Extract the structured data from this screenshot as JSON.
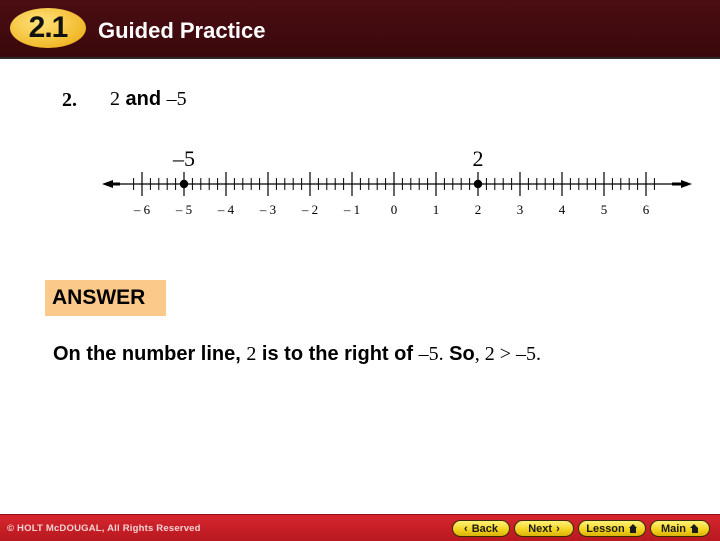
{
  "header": {
    "section_badge": "2.1",
    "title": "Guided Practice"
  },
  "problem": {
    "number": "2.",
    "expr_a": "2",
    "conj": " and ",
    "expr_b": "–5"
  },
  "number_line": {
    "min": -6,
    "max": 6,
    "minor_ticks_per_unit": 5,
    "tick_labels": [
      "– 6",
      "– 5",
      "– 4",
      "– 3",
      "– 2",
      "– 1",
      "0",
      "1",
      "2",
      "3",
      "4",
      "5",
      "6"
    ],
    "points": [
      {
        "value": -5,
        "label": "–5"
      },
      {
        "value": 2,
        "label": "2"
      }
    ]
  },
  "answer": {
    "label": "ANSWER",
    "parts": [
      {
        "text": "On the number line, ",
        "style": "bold"
      },
      {
        "text": "2",
        "style": "serif"
      },
      {
        "text": " is to the right of ",
        "style": "bold"
      },
      {
        "text": "–5.",
        "style": "serif"
      },
      {
        "text": " So",
        "style": "bold"
      },
      {
        "text": ", 2 > –5.",
        "style": "serif"
      }
    ]
  },
  "footer": {
    "copyright": "© HOLT McDOUGAL, All Rights Reserved",
    "nav": [
      {
        "label": "Back",
        "icon": "chevron-left-icon"
      },
      {
        "label": "Next",
        "icon": "chevron-right-icon"
      },
      {
        "label": "Lesson",
        "icon": "home-icon"
      },
      {
        "label": "Main",
        "icon": "home-icon"
      }
    ]
  }
}
